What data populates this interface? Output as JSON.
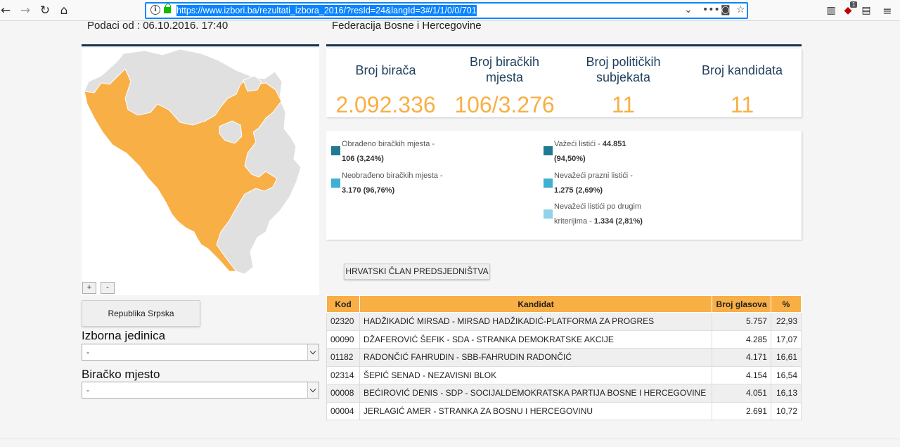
{
  "browser": {
    "url": "https://www.izbori.ba/rezultati_izbora_2016/?resId=24&langId=3#/1/1/0/0/701",
    "badge_count": "1"
  },
  "left": {
    "header_text": "Podaci od : 06.10.2016. 17:40",
    "zoom_in": "+",
    "zoom_out": "-",
    "entity_button": "Republika Srpska",
    "izborna_jedinica_label": "Izborna jedinica",
    "izborna_jedinica_value": "-",
    "biracko_mjesto_label": "Biračko mjesto",
    "biracko_mjesto_value": "-"
  },
  "right": {
    "header_text": "Federacija Bosne i Hercegovine",
    "stats": [
      {
        "label1": "Broj birača",
        "label2": "",
        "value": "2.092.336"
      },
      {
        "label1": "Broj biračkih",
        "label2": "mjesta",
        "value": "106/3.276"
      },
      {
        "label1": "Broj političkih",
        "label2": "subjekata",
        "value": "11"
      },
      {
        "label1": "Broj kandidata",
        "label2": "",
        "value": "11"
      }
    ],
    "legend": [
      {
        "text1": "Obrađeno biračkih mjesta -",
        "bold": "106 (3,24%)",
        "color": "#217a92"
      },
      {
        "text1": "Neobrađeno biračkih mjesta -",
        "bold": "3.170 (96,76%)",
        "color": "#3fb0d4"
      },
      {
        "text1": "Važeći listići -",
        "bold1": "44.851",
        "bold2": "(94,50%)",
        "color": "#217a92"
      },
      {
        "text1": "Nevažeći prazni listići -",
        "bold": "1.275 (2,69%)",
        "color": "#3fb0d4"
      },
      {
        "text1": "Nevažeći listići po drugim",
        "text2": "kriterijima -",
        "bold": "1.334 (2,81%)",
        "color": "#8fd3ea"
      }
    ],
    "tab_button": "HRVATSKI ČLAN PREDSJEDNIŠTVA",
    "table": {
      "headers": [
        "Kod",
        "Kandidat",
        "Broj glasova",
        "%"
      ],
      "rows": [
        [
          "02320",
          "HADŽIKADIĆ MIRSAD - MIRSAD HADŽIKADIĆ-PLATFORMA ZA PROGRES",
          "5.757",
          "22,93"
        ],
        [
          "00090",
          "DŽAFEROVIĆ ŠEFIK - SDA - STRANKA DEMOKRATSKE AKCIJE",
          "4.285",
          "17,07"
        ],
        [
          "01182",
          "RADONČIĆ FAHRUDIN - SBB-FAHRUDIN RADONČIĆ",
          "4.171",
          "16,61"
        ],
        [
          "02314",
          "ŠEPIĆ SENAD - NEZAVISNI BLOK",
          "4.154",
          "16,54"
        ],
        [
          "00008",
          "BEĆIROVIĆ DENIS - SDP - SOCIJALDEMOKRATSKA PARTIJA BOSNE I HERCEGOVINE",
          "4.051",
          "16,13"
        ],
        [
          "00004",
          "JERLAGIĆ AMER - STRANKA ZA BOSNU I HERCEGOVINU",
          "2.691",
          "10,72"
        ]
      ]
    }
  },
  "colors": {
    "accent_orange": "#f8af45",
    "header_navy": "#14334f",
    "map_grey": "#e0e0e0"
  }
}
